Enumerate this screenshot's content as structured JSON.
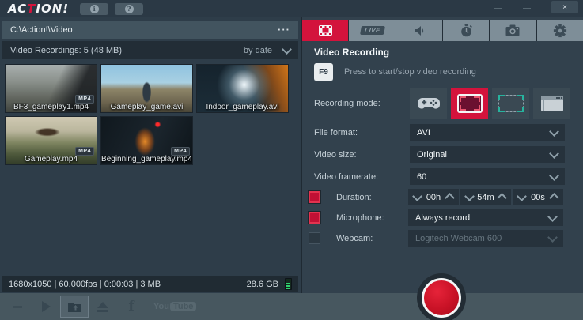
{
  "window": {
    "minimize": "–",
    "close": "×"
  },
  "logo": {
    "pre": "AC",
    "accent": "T",
    "post": "ION!"
  },
  "topbar": {
    "info_label": "i",
    "help_label": "?"
  },
  "left": {
    "path": "C:\\Action!\\Video",
    "path_menu": "···",
    "list_title": "Video Recordings: 5 (48 MB)",
    "sort_label": "by date",
    "items": [
      {
        "name": "BF3_gameplay1.mp4",
        "badge": "MP4"
      },
      {
        "name": "Gameplay_game.avi",
        "badge": ""
      },
      {
        "name": "Indoor_gameplay.avi",
        "badge": ""
      },
      {
        "name": "Gameplay.mp4",
        "badge": "MP4"
      },
      {
        "name": "Beginning_gameplay.mp4",
        "badge": "MP4"
      }
    ],
    "status": "1680x1050 | 60.000fps | 0:00:03 | 3 MB",
    "free_space": "28.6 GB"
  },
  "tabs": {
    "live_label": "LIVE"
  },
  "panel": {
    "title": "Video Recording",
    "hotkey": "F9",
    "hotkey_hint": "Press to start/stop video recording",
    "recording_mode_label": "Recording mode:",
    "file_format_label": "File format:",
    "file_format_value": "AVI",
    "video_size_label": "Video size:",
    "video_size_value": "Original",
    "framerate_label": "Video framerate:",
    "framerate_value": "60",
    "duration_label": "Duration:",
    "duration_h": "00h",
    "duration_m": "54m",
    "duration_s": "00s",
    "microphone_label": "Microphone:",
    "microphone_value": "Always record",
    "webcam_label": "Webcam:",
    "webcam_value": "Logitech Webcam 600"
  },
  "colors": {
    "accent": "#d3133c",
    "record_red": "#c81226",
    "teal": "#27b39e"
  }
}
